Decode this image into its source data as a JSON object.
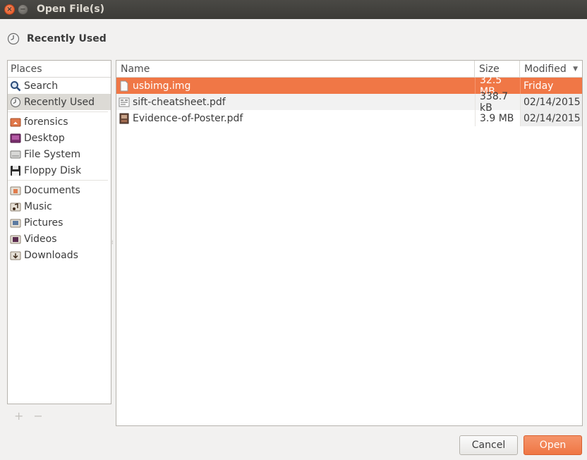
{
  "window": {
    "title": "Open File(s)"
  },
  "location": {
    "label": "Recently Used",
    "icon": "clock-icon"
  },
  "places": {
    "header": "Places",
    "groups": [
      [
        {
          "label": "Search",
          "icon": "search-icon"
        },
        {
          "label": "Recently Used",
          "icon": "clock-icon",
          "selected": true
        }
      ],
      [
        {
          "label": "forensics",
          "icon": "home-folder-icon"
        },
        {
          "label": "Desktop",
          "icon": "desktop-icon"
        },
        {
          "label": "File System",
          "icon": "drive-icon"
        },
        {
          "label": "Floppy Disk",
          "icon": "floppy-icon"
        }
      ],
      [
        {
          "label": "Documents",
          "icon": "documents-folder-icon"
        },
        {
          "label": "Music",
          "icon": "music-folder-icon"
        },
        {
          "label": "Pictures",
          "icon": "pictures-folder-icon"
        },
        {
          "label": "Videos",
          "icon": "videos-folder-icon"
        },
        {
          "label": "Downloads",
          "icon": "downloads-folder-icon"
        }
      ]
    ],
    "add_label": "+",
    "remove_label": "−"
  },
  "files": {
    "columns": {
      "name": "Name",
      "size": "Size",
      "modified": "Modified"
    },
    "sort_indicator": "▼",
    "rows": [
      {
        "name": "usbimg.img",
        "size": "32.5 MB",
        "modified": "Friday",
        "icon": "generic-file-icon",
        "selected": true
      },
      {
        "name": "sift-cheatsheet.pdf",
        "size": "338.7 kB",
        "modified": "02/14/2015",
        "icon": "pdf-document-icon"
      },
      {
        "name": "Evidence-of-Poster.pdf",
        "size": "3.9 MB",
        "modified": "02/14/2015",
        "icon": "pdf-image-icon"
      }
    ]
  },
  "buttons": {
    "cancel": "Cancel",
    "open": "Open"
  },
  "colors": {
    "accent": "#f07746",
    "titlebar": "#3c3b37",
    "close": "#e2531f"
  }
}
